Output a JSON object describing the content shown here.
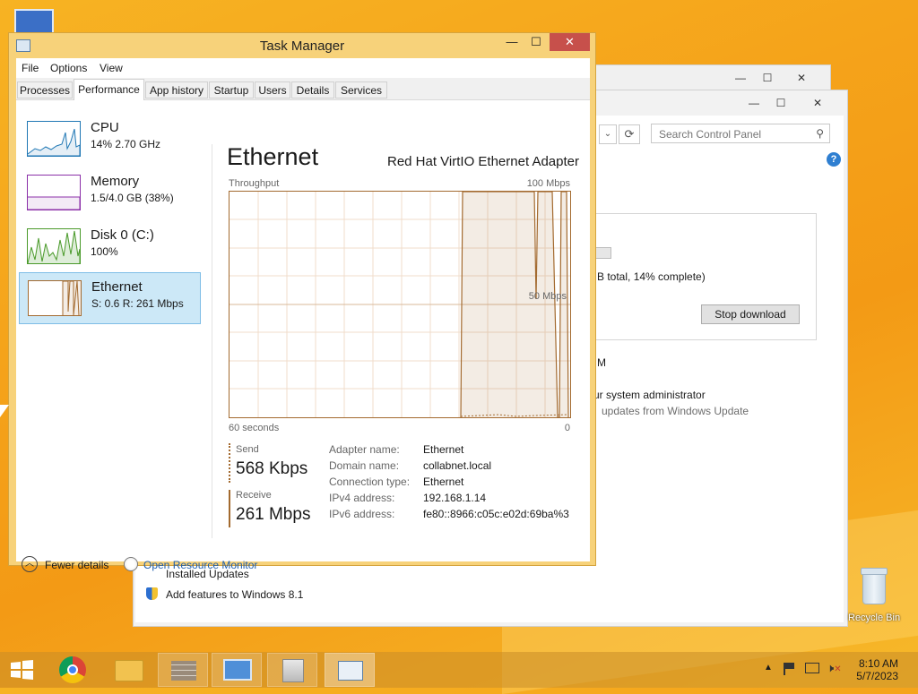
{
  "taskmanager": {
    "title": "Task Manager",
    "menu": [
      "File",
      "Options",
      "View"
    ],
    "tabs": [
      "Processes",
      "Performance",
      "App history",
      "Startup",
      "Users",
      "Details",
      "Services"
    ],
    "active_tab": "Performance",
    "sidebar": [
      {
        "name": "CPU",
        "sub": "14%  2.70 GHz",
        "color": "#1f77b4"
      },
      {
        "name": "Memory",
        "sub": "1.5/4.0 GB (38%)",
        "color": "#8b2fa8"
      },
      {
        "name": "Disk 0 (C:)",
        "sub": "100%",
        "color": "#4a9a2a"
      },
      {
        "name": "Ethernet",
        "sub": "S: 0.6  R: 261 Mbps",
        "color": "#a36a2f"
      }
    ],
    "heading": "Ethernet",
    "adapter": "Red Hat VirtIO Ethernet Adapter",
    "graph": {
      "label_tl": "Throughput",
      "label_tr": "100 Mbps",
      "label_mid": "50 Mbps",
      "label_bl": "60 seconds",
      "label_br": "0"
    },
    "send": {
      "label": "Send",
      "value": "568 Kbps"
    },
    "receive": {
      "label": "Receive",
      "value": "261 Mbps"
    },
    "details": {
      "labels": [
        "Adapter name:",
        "Domain name:",
        "Connection type:",
        "IPv4 address:",
        "IPv6 address:"
      ],
      "values": [
        "Ethernet",
        "collabnet.local",
        "Ethernet",
        "192.168.1.14",
        "fe80::8966:c05c:e02d:69ba%3"
      ]
    },
    "fewer_details": "Fewer details",
    "open_resource_monitor": "Open Resource Monitor"
  },
  "control_panel": {
    "search_placeholder": "Search Control Panel",
    "progress_text": "B total, 14% complete)",
    "stop_download": "Stop download",
    "text_m": "M",
    "sys_admin": "ur system administrator",
    "updates": "updates from Windows Update",
    "installed_updates": "Installed Updates",
    "add_features": "Add features to Windows 8.1"
  },
  "desktop": {
    "recycle_bin": "Recycle Bin"
  },
  "taskbar": {
    "time": "8:10 AM",
    "date": "5/7/2023"
  },
  "colors": {
    "accent_ethernet": "#a36a2f",
    "selection": "#cce8f7",
    "close_red": "#c7504b"
  }
}
